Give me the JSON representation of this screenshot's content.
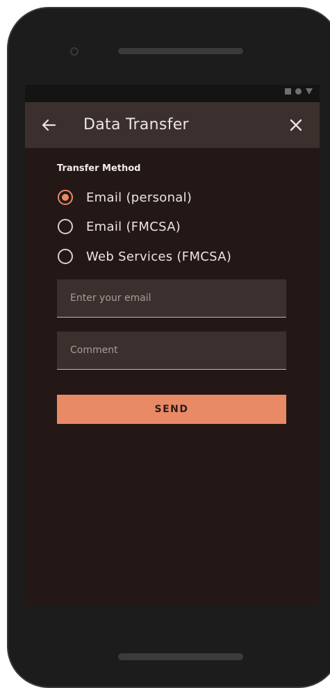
{
  "appbar": {
    "title": "Data Transfer",
    "back_icon": "arrow-left-icon",
    "close_icon": "close-icon"
  },
  "status_icons": [
    "square-icon",
    "circle-icon",
    "triangle-icon"
  ],
  "transfer_method": {
    "label": "Transfer Method",
    "options": [
      {
        "label": "Email (personal)",
        "selected": true
      },
      {
        "label": "Email (FMCSA)",
        "selected": false
      },
      {
        "label": "Web Services (FMCSA)",
        "selected": false
      }
    ]
  },
  "email_field": {
    "placeholder": "Enter your email",
    "value": ""
  },
  "comment_field": {
    "placeholder": "Comment",
    "value": ""
  },
  "send_label": "SEND",
  "colors": {
    "accent": "#e98a66",
    "background": "#231816",
    "surface": "#3b302d"
  }
}
